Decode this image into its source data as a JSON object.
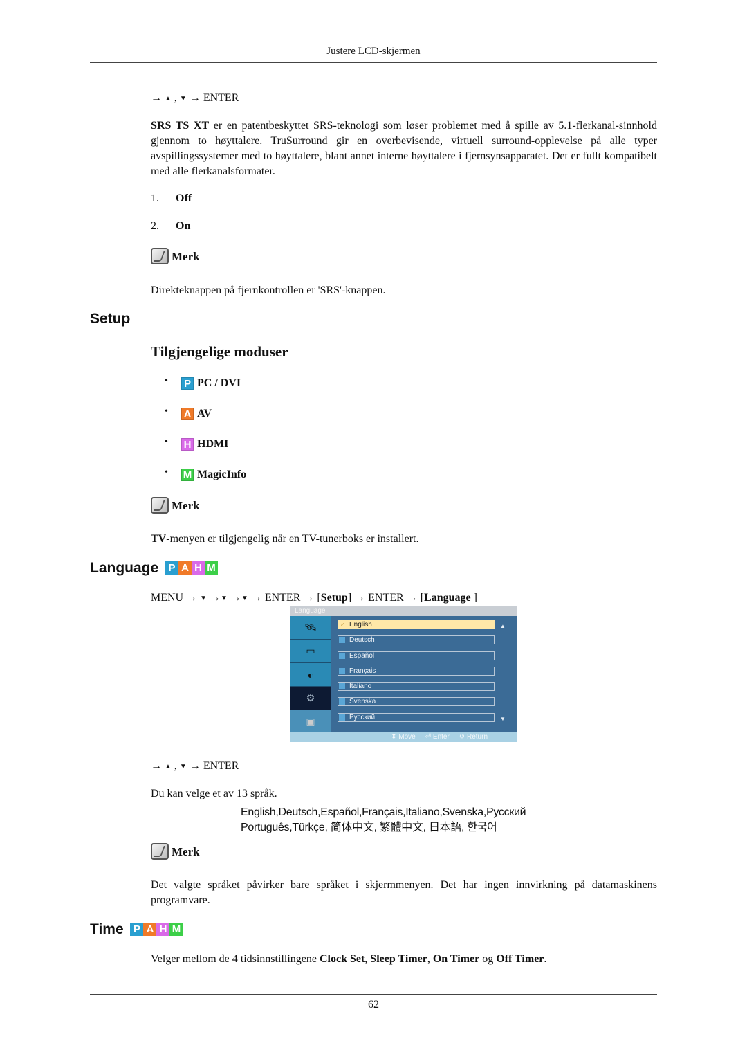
{
  "header": {
    "title": "Justere LCD-skjermen"
  },
  "srs_section": {
    "nav": {
      "prefix": "→",
      "up": "▲",
      "sep": " , ",
      "down": "▼",
      "suffix": "→ ENTER"
    },
    "para_bold": "SRS TS XT",
    "para_text": " er en patentbeskyttet SRS-teknologi som løser problemet med å spille av 5.1-flerkanal-sinnhold gjennom to høyttalere. TruSurround gir en overbevisende, virtuell surround-opplevelse på alle typer avspillingssystemer med to høyttalere, blant annet interne høyttalere i fjernsynsapparatet. Det er fullt kompatibelt med alle flerkanalsformater.",
    "options": [
      {
        "num": "1.",
        "label": "Off"
      },
      {
        "num": "2.",
        "label": "On"
      }
    ],
    "note_label": "Merk",
    "note_text": "Direkteknappen på fjernkontrollen er 'SRS'-knappen."
  },
  "setup_section": {
    "heading": "Setup",
    "subheading": "Tilgjengelige moduser",
    "modes": [
      {
        "icon": "P",
        "label": "PC / DVI",
        "color": "#2a9fd0"
      },
      {
        "icon": "A",
        "label": "AV",
        "color": "#f07a28"
      },
      {
        "icon": "H",
        "label": "HDMI",
        "color": "#d96ae8"
      },
      {
        "icon": "M",
        "label": "MagicInfo",
        "color": "#3ccf48"
      }
    ],
    "note_label": "Merk",
    "note_bold": "TV",
    "note_text": "-menyen er tilgjengelig når en TV-tunerboks er installert."
  },
  "language_section": {
    "heading": "Language",
    "badges": [
      "P",
      "A",
      "H",
      "M"
    ],
    "badge_colors": [
      "#2a9fd0",
      "#f07a28",
      "#d96ae8",
      "#3ccf48"
    ],
    "menu_path": {
      "p1": "MENU → ",
      "down": "▼",
      "p2": " →",
      "p3": " →",
      "p4": " → ENTER → [",
      "setup": "Setup",
      "p5": "] → ENTER → [",
      "language": "Language ",
      "p6": "]"
    },
    "osd": {
      "title": "Language",
      "side_icons": [
        "picture-icon",
        "sound-icon",
        "channel-icon",
        "setup-gear-icon",
        "input-icon"
      ],
      "items": [
        "English",
        "Deutsch",
        "Español",
        "Français",
        "Italiano",
        "Svenska",
        "Русский"
      ],
      "selected": "English",
      "footer": {
        "move": "Move",
        "enter": "Enter",
        "return": "Return"
      },
      "colors": {
        "panel": "#3b6b96",
        "sidebar": "#2a8ab5",
        "sidebar_active": "#0d1a33",
        "selected": "#ffe8a8",
        "footer": "#a9d1e4"
      }
    },
    "nav": {
      "prefix": "→",
      "up": "▲",
      "sep": " , ",
      "down": "▼",
      "suffix": "→ ENTER"
    },
    "count_text": "Du kan velge et av 13 språk.",
    "lang_line1": "English,Deutsch,Español,Français,Italiano,Svenska,Русский",
    "lang_line2": "Português,Türkçe, 简体中文,  繁體中文, 日本語, 한국어",
    "note_label": "Merk",
    "note_text": "Det valgte språket påvirker bare språket i skjermmenyen. Det har ingen innvirkning på datamaskinens programvare."
  },
  "time_section": {
    "heading": "Time",
    "badges": [
      "P",
      "A",
      "H",
      "M"
    ],
    "text_pre": "Velger mellom de 4 tidsinnstillingene ",
    "b1": "Clock Set",
    "c1": ", ",
    "b2": "Sleep Timer",
    "c2": ", ",
    "b3": "On Timer",
    "c3": " og ",
    "b4": "Off Timer",
    "c4": "."
  },
  "footer": {
    "page_number": "62"
  }
}
